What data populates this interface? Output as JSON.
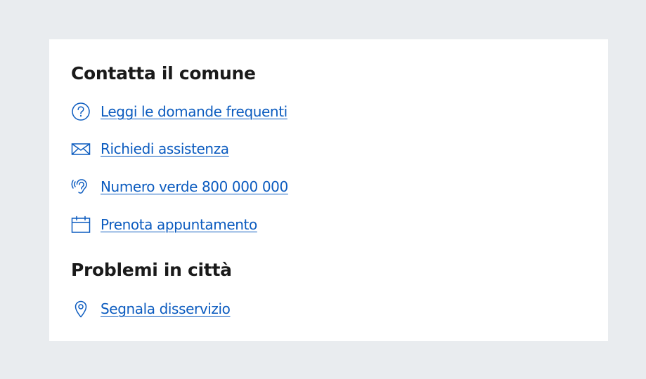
{
  "contact": {
    "title": "Contatta il comune",
    "links": [
      {
        "label": "Leggi le domande frequenti",
        "icon": "help-circle-icon"
      },
      {
        "label": "Richiedi assistenza",
        "icon": "mail-icon"
      },
      {
        "label": "Numero verde 800 000 000",
        "icon": "hearing-icon"
      },
      {
        "label": "Prenota appuntamento",
        "icon": "calendar-icon"
      }
    ]
  },
  "problems": {
    "title": "Problemi in città",
    "links": [
      {
        "label": "Segnala disservizio",
        "icon": "map-marker-icon"
      }
    ]
  },
  "colors": {
    "link": "#0b5bbf",
    "heading": "#1a1a1a",
    "background": "#e9ecef",
    "card": "#ffffff"
  }
}
